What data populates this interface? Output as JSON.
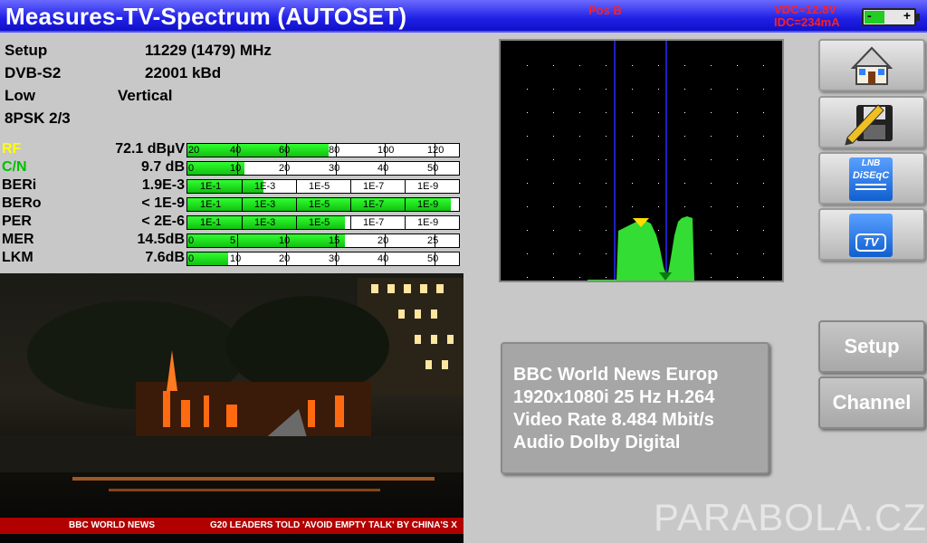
{
  "title": "Measures-TV-Spectrum (AUTOSET)",
  "pos": "Pos B",
  "vdc": "VDC=12.8V",
  "idc": "IDC=234mA",
  "battery": {
    "minus": "-",
    "plus": "+",
    "level": 0.4
  },
  "setup_info": {
    "setup_label": "Setup",
    "frequency": "11229 (1479) MHz",
    "standard": "DVB-S2",
    "symbol_rate": "22001 kBd",
    "band": "Low",
    "polarization": "Vertical",
    "modulation": "8PSK 2/3"
  },
  "measurements": [
    {
      "label": "RF",
      "value": "72.1 dBµV",
      "label_color": "#ffff00",
      "fill": 0.52,
      "ticks": [
        "20",
        "40",
        "60",
        "80",
        "100",
        "120"
      ]
    },
    {
      "label": "C/N",
      "value": "9.7 dB",
      "label_color": "#00c000",
      "fill": 0.21,
      "ticks": [
        "0",
        "10",
        "20",
        "30",
        "40",
        "50"
      ]
    },
    {
      "label": "BERi",
      "value": "1.9E-3",
      "label_color": "#000000",
      "fill": 0.28,
      "ticks": [
        "1E-1",
        "1E-3",
        "1E-5",
        "1E-7",
        "1E-9"
      ]
    },
    {
      "label": "BERo",
      "value": "< 1E-9",
      "label_color": "#000000",
      "fill": 0.97,
      "ticks": [
        "1E-1",
        "1E-3",
        "1E-5",
        "1E-7",
        "1E-9"
      ]
    },
    {
      "label": "PER",
      "value": "< 2E-6",
      "label_color": "#000000",
      "fill": 0.58,
      "ticks": [
        "1E-1",
        "1E-3",
        "1E-5",
        "1E-7",
        "1E-9"
      ]
    },
    {
      "label": "MER",
      "value": "14.5dB",
      "label_color": "#000000",
      "fill": 0.58,
      "ticks": [
        "0",
        "5",
        "10",
        "15",
        "20",
        "25"
      ]
    },
    {
      "label": "LKM",
      "value": "7.6dB",
      "label_color": "#000000",
      "fill": 0.15,
      "ticks": [
        "0",
        "10",
        "20",
        "30",
        "40",
        "50"
      ]
    }
  ],
  "video": {
    "ticker_brand": "BBC WORLD NEWS",
    "ticker_headline": "G20 LEADERS TOLD 'AVOID EMPTY TALK' BY CHINA'S X"
  },
  "buttons": {
    "home_icon": "home-icon",
    "save_icon": "save-icon",
    "lnb_icon": "lnb-diseqc-icon",
    "lnb_text1": "LNB",
    "lnb_text2": "DiSEqC",
    "tv_icon": "tv-icon",
    "tv_text": "TV",
    "setup": "Setup",
    "channel": "Channel"
  },
  "channel_info": {
    "name": "BBC World News Europ",
    "resolution": "1920x1080i 25 Hz H.264",
    "video_rate": "Video Rate 8.484 Mbit/s",
    "audio": "Audio Dolby Digital"
  },
  "watermark": "PARABOLA.CZ",
  "colors": {
    "accent": "#2020e6",
    "bar_fill": "#22cc22",
    "spectrum": "#33dd33",
    "marker": "#ffdd00"
  }
}
